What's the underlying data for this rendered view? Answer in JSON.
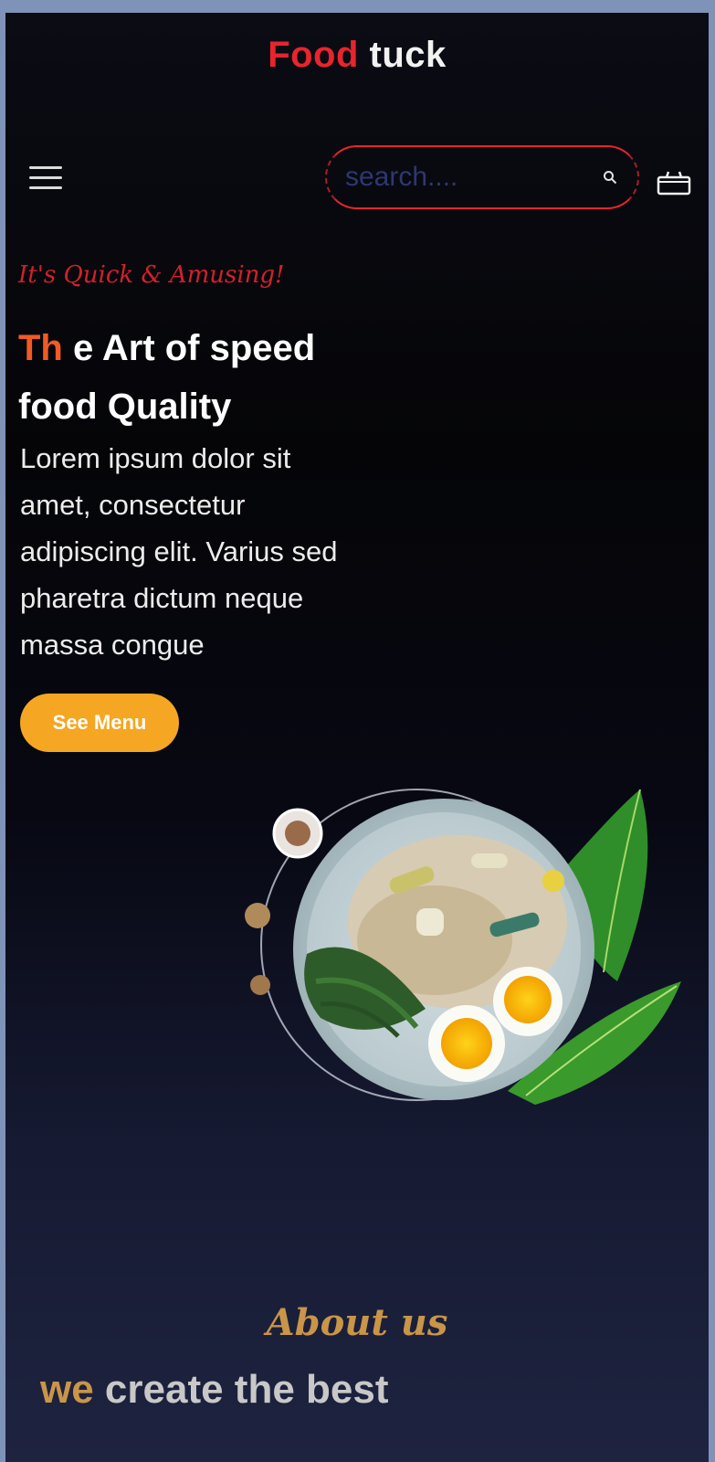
{
  "header": {
    "brand_part1": "Food",
    "brand_part2": "tuck",
    "brand_color_1": "#e8242d",
    "brand_color_2": "#f2f2f2"
  },
  "nav": {
    "menu_icon": "hamburger-menu-icon",
    "search_placeholder": "search....",
    "search_icon": "search-icon",
    "cart_icon": "shopping-basket-icon"
  },
  "hero": {
    "tagline": "It's Quick & Amusing!",
    "headline_accent": "Th",
    "headline_line1_rest": " e Art of speed",
    "headline_line2": "food Quality",
    "description": "Lorem ipsum dolor sit amet, consectetur adipiscing elit. Varius sed pharetra dictum neque massa congue",
    "cta_label": "See Menu",
    "cta_color": "#f5a623",
    "accent_color": "#f15a24"
  },
  "about": {
    "script_title": "About us",
    "heading_word1": "we",
    "heading_rest": " create the best",
    "accent_color": "#c99548"
  }
}
